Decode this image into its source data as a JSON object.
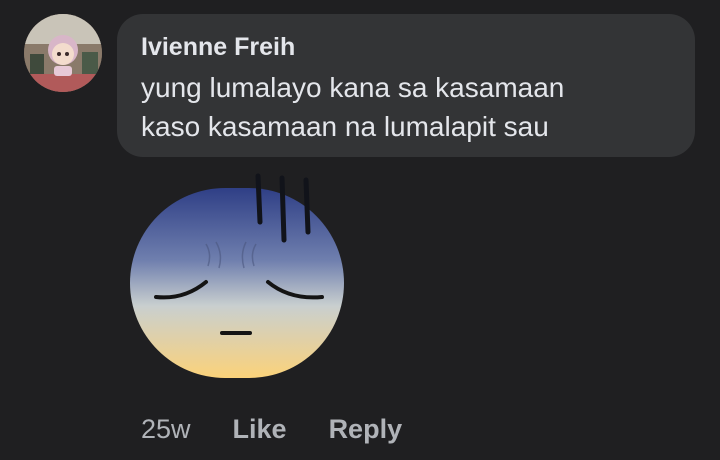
{
  "comment": {
    "author": "Ivienne Freih",
    "text_lines": [
      "yung lumalayo kana sa kasamaan",
      "kaso kasamaan na lumalapit sau"
    ],
    "sticker_icon": "pensive-face-sticker"
  },
  "actions": {
    "timestamp": "25w",
    "like_label": "Like",
    "reply_label": "Reply"
  },
  "colors": {
    "background": "#1f1f21",
    "bubble": "#333436",
    "primary_text": "#e4e6eb",
    "secondary_text": "#b0b3b8"
  }
}
